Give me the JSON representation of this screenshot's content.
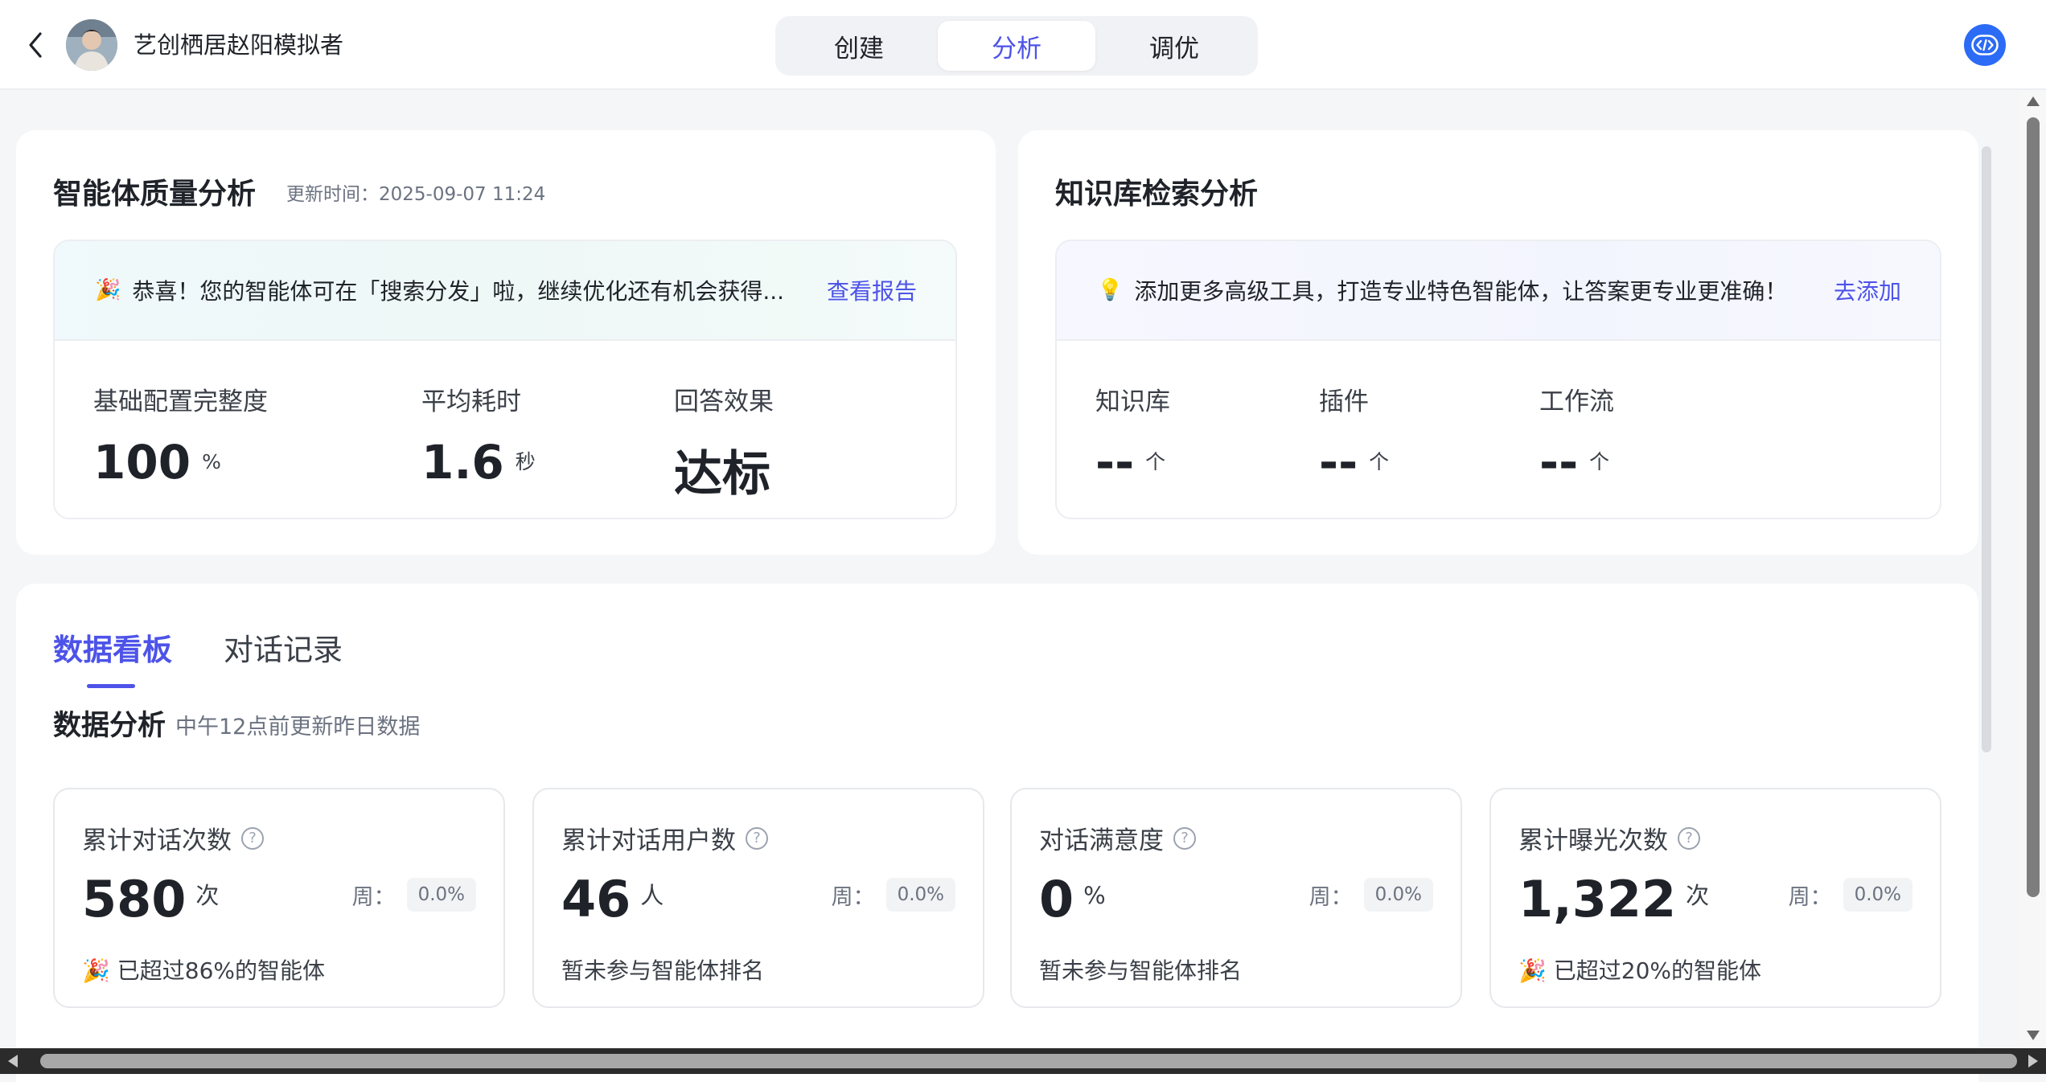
{
  "header": {
    "title": "艺创栖居赵阳模拟者",
    "tabs": [
      {
        "label": "创建",
        "active": false
      },
      {
        "label": "分析",
        "active": true
      },
      {
        "label": "调优",
        "active": false
      }
    ]
  },
  "quality": {
    "title": "智能体质量分析",
    "update_time": "更新时间：2025-09-07 11:24",
    "banner_emoji": "🎉",
    "banner_text": "恭喜！您的智能体可在「搜索分发」啦，继续优化还有机会获得...",
    "banner_link": "查看报告",
    "metrics": [
      {
        "label": "基础配置完整度",
        "value": "100",
        "unit": "%"
      },
      {
        "label": "平均耗时",
        "value": "1.6",
        "unit": "秒"
      },
      {
        "label": "回答效果",
        "value": "达标",
        "unit": ""
      }
    ]
  },
  "knowledge": {
    "title": "知识库检索分析",
    "banner_emoji": "💡",
    "banner_text": "添加更多高级工具，打造专业特色智能体，让答案更专业更准确！",
    "banner_link": "去添加",
    "metrics": [
      {
        "label": "知识库",
        "value": "--",
        "unit": "个"
      },
      {
        "label": "插件",
        "value": "--",
        "unit": "个"
      },
      {
        "label": "工作流",
        "value": "--",
        "unit": "个"
      }
    ]
  },
  "dashboard": {
    "tabs": [
      {
        "label": "数据看板",
        "active": true
      },
      {
        "label": "对话记录",
        "active": false
      }
    ],
    "section_title": "数据分析",
    "section_sub": "中午12点前更新昨日数据",
    "week_label": "周：",
    "help_glyph": "?",
    "stats": [
      {
        "title": "累计对话次数",
        "value": "580",
        "unit": "次",
        "week": "0.0%",
        "foot_emoji": "🎉",
        "foot": "已超过86%的智能体"
      },
      {
        "title": "累计对话用户数",
        "value": "46",
        "unit": "人",
        "week": "0.0%",
        "foot_emoji": "",
        "foot": "暂未参与智能体排名"
      },
      {
        "title": "对话满意度",
        "value": "0",
        "unit": "%",
        "week": "0.0%",
        "foot_emoji": "",
        "foot": "暂未参与智能体排名"
      },
      {
        "title": "累计曝光次数",
        "value": "1,322",
        "unit": "次",
        "week": "0.0%",
        "foot_emoji": "🎉",
        "foot": "已超过20%的智能体"
      }
    ]
  },
  "colors": {
    "accent": "#4d53e8",
    "code_button": "#2c6bf5"
  }
}
